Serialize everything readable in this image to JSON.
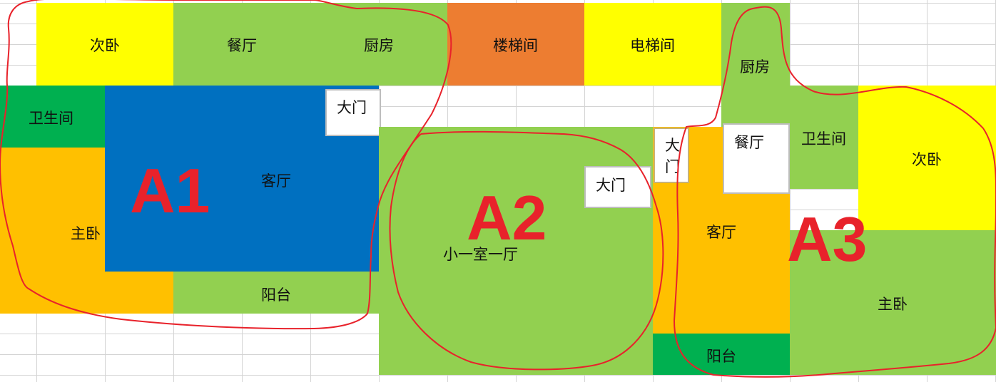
{
  "colors": {
    "yellow": "#ffff00",
    "light_green": "#92d050",
    "orange": "#ed7d31",
    "dark_green": "#00b050",
    "blue": "#0070c0",
    "amber": "#ffc000",
    "red_annotation": "#e8222b"
  },
  "top_row": {
    "secondary_bedroom": "次卧",
    "dining_room": "餐厅",
    "kitchen": "厨房",
    "stairwell": "楼梯间",
    "elevator_room": "电梯间"
  },
  "unit_a1": {
    "zone_label": "A1",
    "bathroom": "卫生间",
    "master_bedroom": "主卧",
    "living_room": "客厅",
    "main_door": "大门",
    "balcony": "阳台"
  },
  "unit_a2": {
    "zone_label": "A2",
    "studio": "小一室一厅",
    "main_door": "大门"
  },
  "unit_a3": {
    "zone_label": "A3",
    "kitchen": "厨房",
    "main_door": "大门",
    "dining_room": "餐厅",
    "bathroom": "卫生间",
    "secondary_bedroom": "次卧",
    "living_room": "客厅",
    "master_bedroom": "主卧",
    "balcony": "阳台"
  }
}
